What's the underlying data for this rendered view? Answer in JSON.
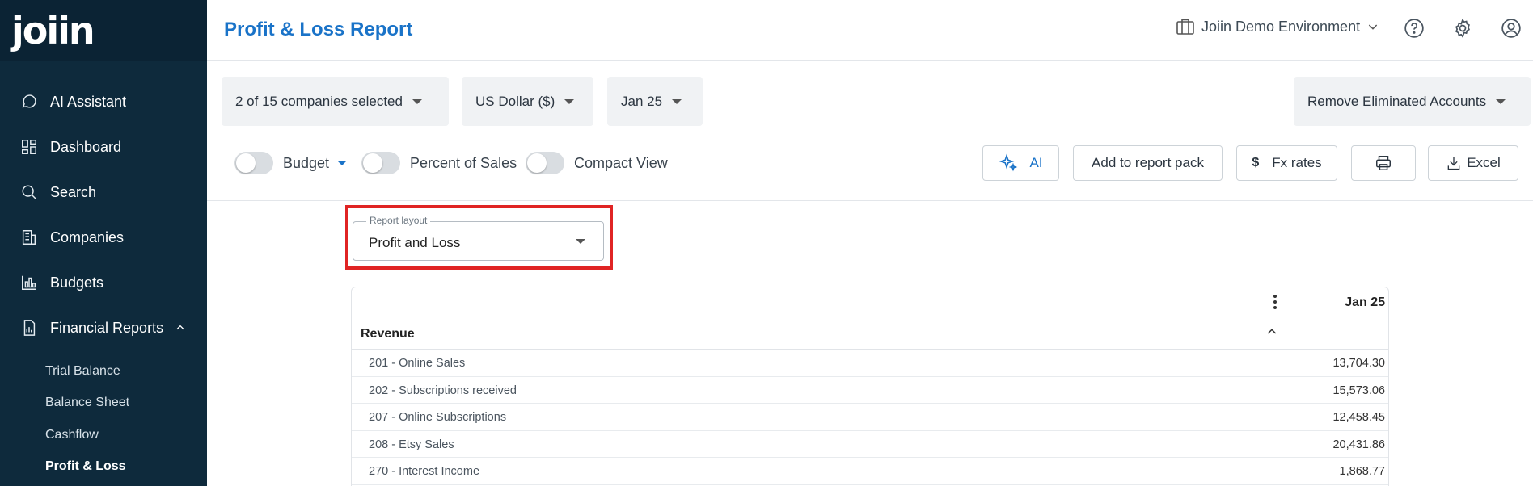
{
  "app": {
    "logo": "joiin"
  },
  "sidebar": {
    "items": [
      {
        "label": "AI Assistant",
        "icon": "chat-bubble-icon"
      },
      {
        "label": "Dashboard",
        "icon": "dashboard-grid-icon"
      },
      {
        "label": "Search",
        "icon": "search-icon"
      },
      {
        "label": "Companies",
        "icon": "building-icon"
      },
      {
        "label": "Budgets",
        "icon": "bar-chart-icon"
      },
      {
        "label": "Financial Reports",
        "icon": "document-report-icon",
        "expanded": true
      }
    ],
    "sub_items": [
      "Trial Balance",
      "Balance Sheet",
      "Cashflow",
      "Profit & Loss"
    ],
    "active_sub": "Profit & Loss"
  },
  "header": {
    "title": "Profit & Loss Report",
    "environment": "Joiin Demo Environment",
    "icons": [
      "help-circle-icon",
      "gear-icon",
      "user-circle-icon"
    ]
  },
  "filters": {
    "companies": "2 of 15 companies selected",
    "currency": "US Dollar ($)",
    "period": "Jan 25",
    "eliminated": "Remove Eliminated Accounts"
  },
  "toggles": {
    "budget": "Budget",
    "percent_of_sales": "Percent of Sales",
    "compact_view": "Compact View"
  },
  "actions": {
    "ai": "AI",
    "report_pack": "Add to report pack",
    "fx_rates": "Fx rates",
    "excel": "Excel"
  },
  "report_layout": {
    "legend": "Report layout",
    "value": "Profit and Loss"
  },
  "table": {
    "column": "Jan 25",
    "section": "Revenue",
    "rows": [
      {
        "account": "201 - Online Sales",
        "value": "13,704.30"
      },
      {
        "account": "202 - Subscriptions received",
        "value": "15,573.06"
      },
      {
        "account": "207 - Online Subscriptions",
        "value": "12,458.45"
      },
      {
        "account": "208 - Etsy Sales",
        "value": "20,431.86"
      },
      {
        "account": "270 - Interest Income",
        "value": "1,868.77"
      }
    ]
  },
  "colors": {
    "sidebar_bg": "#0e2a3c",
    "accent": "#1a73c8",
    "highlight": "#e02424"
  }
}
